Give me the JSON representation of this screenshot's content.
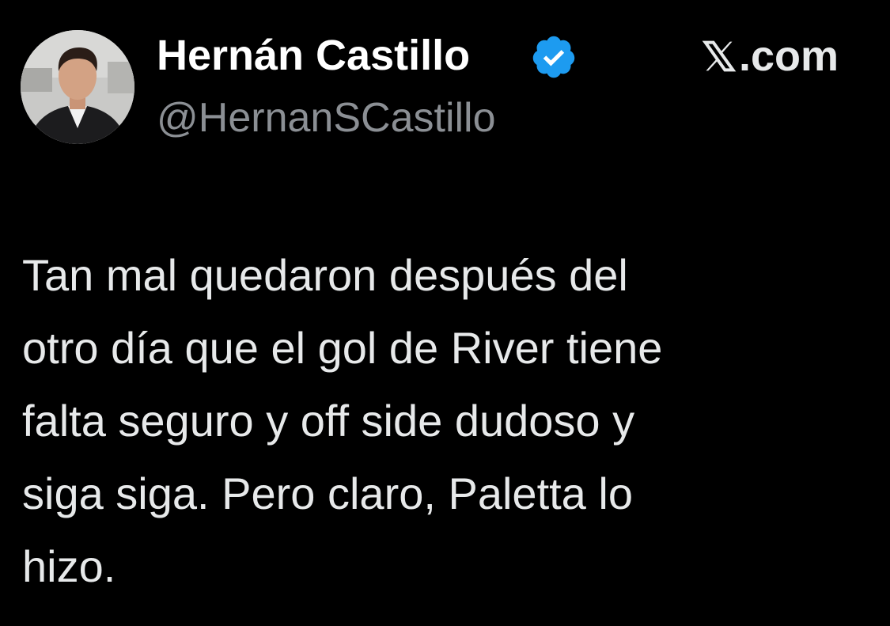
{
  "author": {
    "display_name": "Hernán Castillo",
    "handle": "@HernanSCastillo",
    "verified": true,
    "avatar_icon": "person-portrait"
  },
  "brand": {
    "label": ".com",
    "icon": "x-logo-icon"
  },
  "tweet": {
    "text": "Tan mal quedaron después del\notro día que el gol de River tiene\nfalta seguro y off side dudoso y\nsiga siga. Pero claro, Paletta lo\nhizo."
  },
  "colors": {
    "background": "#000000",
    "text": "#e7e9ea",
    "secondary_text": "#8b8f94",
    "verified_badge": "#1d9bf0"
  }
}
